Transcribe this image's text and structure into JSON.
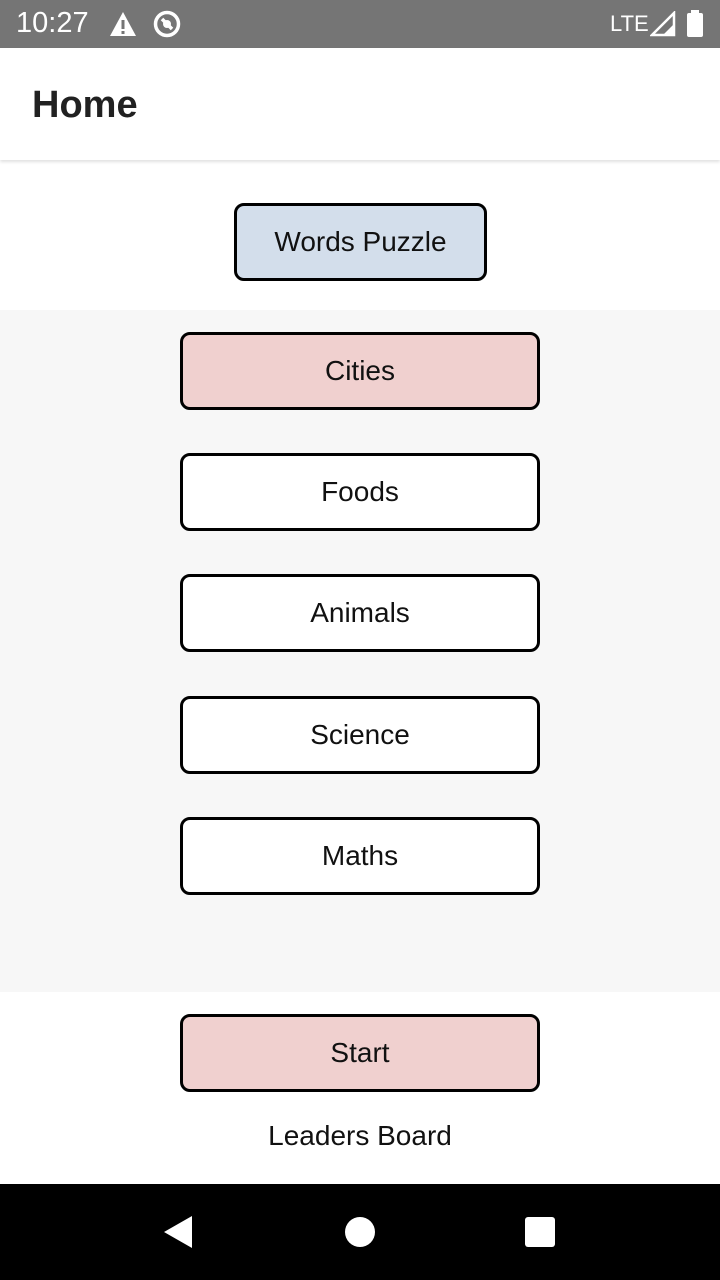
{
  "status_bar": {
    "time": "10:27",
    "network": "LTE"
  },
  "app_bar": {
    "title": "Home"
  },
  "header_button": {
    "label": "Words Puzzle"
  },
  "categories": [
    {
      "label": "Cities",
      "selected": true
    },
    {
      "label": "Foods",
      "selected": false
    },
    {
      "label": "Animals",
      "selected": false
    },
    {
      "label": "Science",
      "selected": false
    },
    {
      "label": "Maths",
      "selected": false
    }
  ],
  "start_button": {
    "label": "Start"
  },
  "leaders_board": {
    "label": "Leaders Board"
  },
  "colors": {
    "status_bar": "#757575",
    "header_button_bg": "#d3deeb",
    "selected_bg": "#f0d0cf",
    "panel_bg": "#f7f7f7"
  },
  "nav_bar": {
    "icons": [
      "back-icon",
      "home-icon",
      "recents-icon"
    ]
  }
}
